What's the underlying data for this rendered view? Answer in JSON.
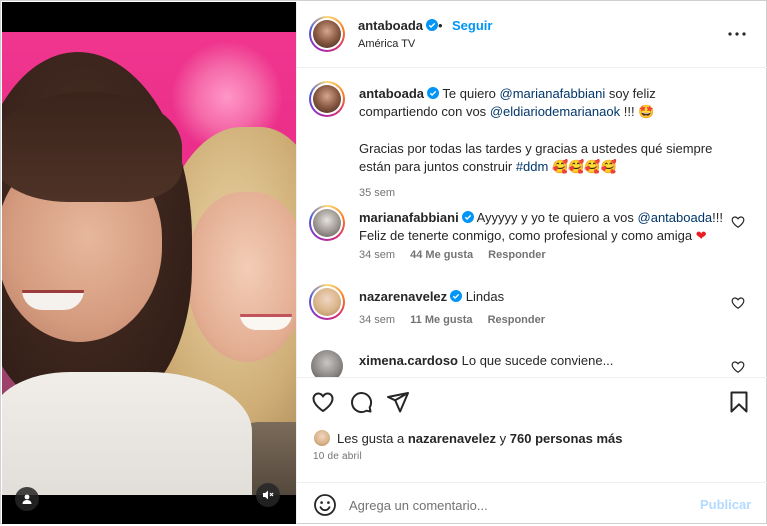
{
  "post": {
    "author": "antaboada",
    "follow_label": "Seguir",
    "dot": "•",
    "location": "América TV",
    "caption": {
      "author": "antaboada",
      "text1": "Te quiero",
      "mention1": "@marianafabbiani",
      "text2": "soy feliz compartiendo con vos",
      "mention2": "@eldiariodemarianaok",
      "text3": "!!!",
      "emoji1": "🤩",
      "text4": "Gracias por todas las tardes y gracias a ustedes qué siempre están para juntos construir",
      "hashtag": "#ddm",
      "emoji2": "🥰🥰🥰🥰",
      "time": "35 sem"
    }
  },
  "comments": [
    {
      "user": "marianafabbiani",
      "text1": "Ayyyyy y yo te quiero a vos",
      "mention": "@antaboada",
      "text2": "!!! Feliz de tenerte conmigo, como profesional y como amiga",
      "emoji": "❤",
      "time": "34 sem",
      "likes": "44 Me gusta",
      "reply": "Responder"
    },
    {
      "user": "nazarenavelez",
      "text1": "Lindas",
      "time": "34 sem",
      "likes": "11 Me gusta",
      "reply": "Responder"
    },
    {
      "user": "ximena.cardoso",
      "text1": "Lo que sucede conviene..."
    }
  ],
  "likes_summary": {
    "prefix": "Les gusta a",
    "user": "nazarenavelez",
    "conj": "y",
    "count": "760 personas más"
  },
  "date": "10 de abril",
  "add_comment": {
    "placeholder": "Agrega un comentario...",
    "publish_label": "Publicar"
  },
  "colors": {
    "accent": "#0095f6",
    "link": "#00376b",
    "muted": "#737373",
    "publish_disabled": "#b3dbff"
  },
  "icons": [
    "verified-icon",
    "more-options-icon",
    "heart-icon",
    "comment-icon",
    "share-icon",
    "save-icon",
    "emoji-icon",
    "user-tag-icon",
    "mute-icon"
  ]
}
